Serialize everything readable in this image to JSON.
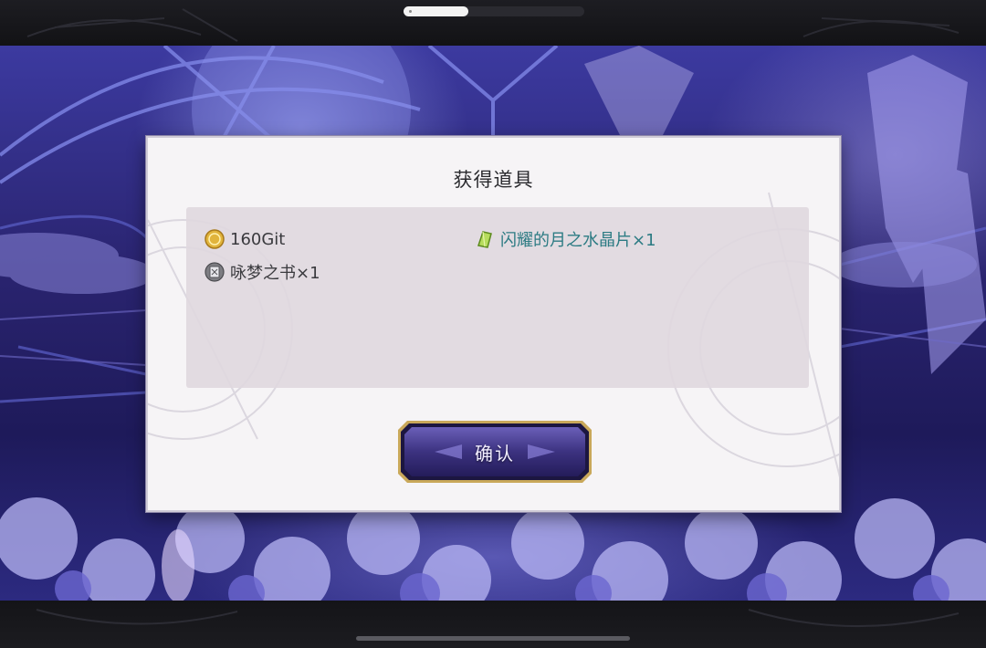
{
  "dialog": {
    "title": "获得道具",
    "items": [
      {
        "icon": "gold-coin-icon",
        "label": "160Git",
        "rare": false
      },
      {
        "icon": "green-crystal-icon",
        "label": "闪耀的月之水晶片×1",
        "rare": true
      },
      {
        "icon": "book-icon",
        "label": "咏梦之书×1",
        "rare": false
      }
    ],
    "confirm_label": "确认"
  },
  "status_bar": {
    "progress": 0.36
  },
  "colors": {
    "rare_item_text": "#2c7b83",
    "normal_item_text": "#3a3a3e",
    "button_gold_frame": "#c9a85a",
    "button_purple": "#4a3f8c"
  }
}
